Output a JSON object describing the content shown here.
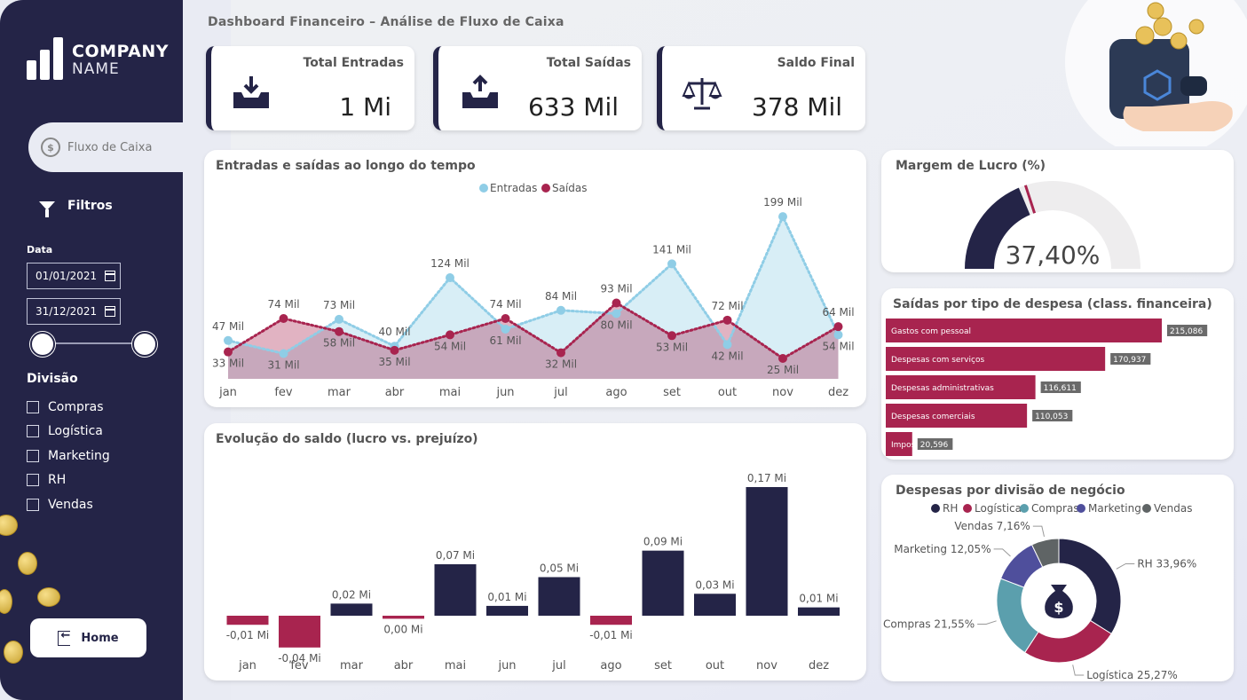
{
  "company": {
    "line1": "COMPANY",
    "line2": "NAME"
  },
  "nav": {
    "active": "Fluxo de Caixa",
    "filters": "Filtros",
    "home": "Home"
  },
  "date_filter": {
    "label": "Data",
    "start": "01/01/2021",
    "end": "31/12/2021"
  },
  "division_filter": {
    "title": "Divisão",
    "items": [
      "Compras",
      "Logística",
      "Marketing",
      "RH",
      "Vendas"
    ]
  },
  "header": {
    "title": "Dashboard Financeiro – Análise de Fluxo de Caixa"
  },
  "kpis": [
    {
      "label": "Total Entradas",
      "value": "1 Mi",
      "icon": "inbox-download-icon"
    },
    {
      "label": "Total Saídas",
      "value": "633 Mil",
      "icon": "inbox-upload-icon"
    },
    {
      "label": "Saldo Final",
      "value": "378 Mil",
      "icon": "balance-scale-icon"
    }
  ],
  "colors": {
    "navy": "#242447",
    "crimson": "#a8244f",
    "lightblue": "#8fcde6",
    "teal": "#5b9fad",
    "purple": "#4f4f9c",
    "gray": "#5f6465"
  },
  "chart_data": [
    {
      "type": "area",
      "title": "Entradas e saídas ao longo do tempo",
      "categories": [
        "jan",
        "fev",
        "mar",
        "abr",
        "mai",
        "jun",
        "jul",
        "ago",
        "set",
        "out",
        "nov",
        "dez"
      ],
      "series": [
        {
          "name": "Entradas",
          "values": [
            47,
            31,
            73,
            40,
            124,
            61,
            84,
            80,
            141,
            42,
            199,
            54
          ],
          "labels": [
            "47 Mil",
            "31 Mil",
            "73 Mil",
            "40 Mil",
            "124 Mil",
            "61 Mil",
            "84 Mil",
            "80 Mil",
            "141 Mil",
            "42 Mil",
            "199 Mil",
            "54 Mil"
          ]
        },
        {
          "name": "Saídas",
          "values": [
            33,
            74,
            58,
            35,
            54,
            74,
            32,
            93,
            53,
            72,
            25,
            64
          ],
          "labels": [
            "33 Mil",
            "74 Mil",
            "58 Mil",
            "35 Mil",
            "54 Mil",
            "74 Mil",
            "32 Mil",
            "93 Mil",
            "53 Mil",
            "72 Mil",
            "25 Mil",
            "64 Mil"
          ]
        }
      ],
      "legend": "top-center"
    },
    {
      "type": "bar",
      "title": "Evolução do saldo (lucro vs. prejuízo)",
      "categories": [
        "jan",
        "fev",
        "mar",
        "abr",
        "mai",
        "jun",
        "jul",
        "ago",
        "set",
        "out",
        "nov",
        "dez"
      ],
      "values": [
        -0.01,
        -0.04,
        0.02,
        0.0,
        0.07,
        0.01,
        0.05,
        -0.01,
        0.09,
        0.03,
        0.17,
        0.01
      ],
      "bar_heights": [
        -0.012,
        -0.042,
        0.016,
        -0.004,
        0.068,
        0.013,
        0.051,
        -0.012,
        0.086,
        0.029,
        0.17,
        0.011
      ],
      "labels": [
        "-0,01 Mi",
        "-0,04 Mi",
        "0,02 Mi",
        "0,00 Mi",
        "0,07 Mi",
        "0,01 Mi",
        "0,05 Mi",
        "-0,01 Mi",
        "0,09 Mi",
        "0,03 Mi",
        "0,17 Mi",
        "0,01 Mi"
      ]
    },
    {
      "type": "gauge",
      "title": "Margem de Lucro (%)",
      "value": 37.4,
      "label": "37,40%",
      "target": 40
    },
    {
      "type": "bar",
      "orientation": "horizontal",
      "title": "Saídas por tipo de despesa (class. financeira)",
      "categories": [
        "Gastos com pessoal",
        "Despesas com serviços",
        "Despesas administrativas",
        "Despesas comerciais",
        "Impostos"
      ],
      "category_labels": [
        "Gastos com pessoal",
        "Despesas com serviços",
        "Despesas administrativas",
        "Despesas comerciais",
        "Impos"
      ],
      "values": [
        215086,
        170937,
        116611,
        110053,
        20596
      ],
      "labels": [
        "215,086",
        "170,937",
        "116,611",
        "110,053",
        "20,596"
      ]
    },
    {
      "type": "pie",
      "title": "Despesas por divisão de negócio",
      "categories": [
        "RH",
        "Logística",
        "Compras",
        "Marketing",
        "Vendas"
      ],
      "values": [
        33.96,
        25.27,
        21.55,
        12.05,
        7.16
      ],
      "labels": [
        "RH 33,96%",
        "Logística 25,27%",
        "Compras 21,55%",
        "Marketing 12,05%",
        "Vendas 7,16%"
      ],
      "center_icon": "money-bag-icon",
      "legend": "top"
    }
  ]
}
